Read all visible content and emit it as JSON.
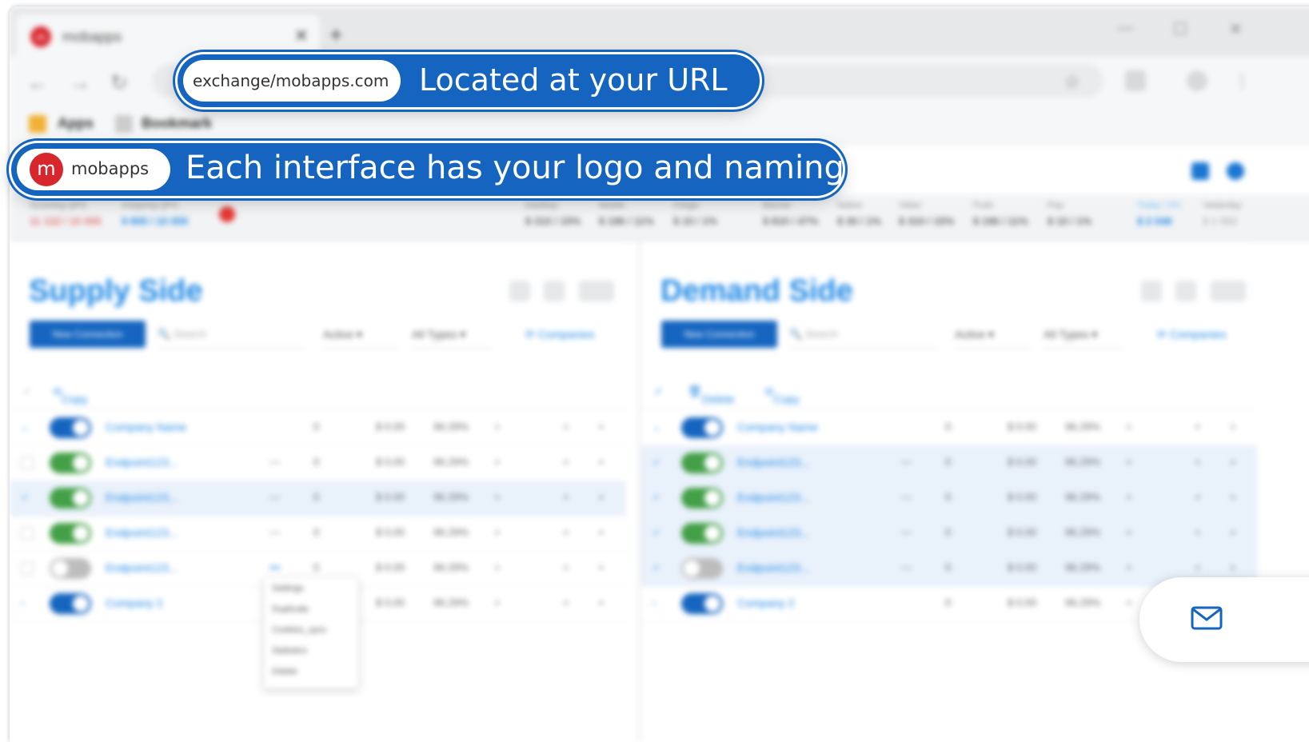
{
  "browser": {
    "tab_title": "mobapps",
    "tab_logo_letter": "m",
    "bookmarks": [
      {
        "label": "Apps"
      },
      {
        "label": "Bookmark"
      }
    ]
  },
  "stats": [
    {
      "label": "Incoming QPS",
      "value": "11 122 / 10 000"
    },
    {
      "label": "Outgoing QPS",
      "value": "9 800 / 10 000"
    },
    {
      "label": "Desktop",
      "value": "$ 310 / 15%"
    },
    {
      "label": "Mobile",
      "value": "$ 196 / 11%"
    },
    {
      "label": "Ctstge",
      "value": "$ 10 / 1%"
    },
    {
      "label": "Banner",
      "value": "$ 810 / 47%"
    },
    {
      "label": "Native",
      "value": "$ 30 / 1%"
    },
    {
      "label": "Video",
      "value": "$ 310 / 15%"
    },
    {
      "label": "Push",
      "value": "$ 196 / 11%"
    },
    {
      "label": "Pop",
      "value": "$ 10 / 1%"
    },
    {
      "label": "Today / 0%",
      "value": "$ 2 048"
    },
    {
      "label": "Yesterday",
      "value": "$ 1 992"
    }
  ],
  "supply": {
    "title": "Supply Side",
    "new_button": "New Connection",
    "search_placeholder": "Search",
    "status_select": "Active",
    "type_select": "All Types",
    "compare": "Companies",
    "bulk": [
      "Copy"
    ],
    "rows": [
      {
        "name": "Company Name",
        "dash": "",
        "count": "0",
        "money": "$ 0.00",
        "pct": "96.29%"
      },
      {
        "name": "Endpoint123...",
        "dash": "—",
        "count": "0",
        "money": "$ 0.00",
        "pct": "96.29%"
      },
      {
        "name": "Endpoint123...",
        "dash": "—",
        "count": "0",
        "money": "$ 0.00",
        "pct": "96.29%"
      },
      {
        "name": "Endpoint123...",
        "dash": "—",
        "count": "0",
        "money": "$ 0.00",
        "pct": "96.29%"
      },
      {
        "name": "Endpoint123...",
        "dash": "•••",
        "count": "0",
        "money": "$ 0.00",
        "pct": "96.29%"
      },
      {
        "name": "Company 2",
        "dash": "",
        "count": "0",
        "money": "$ 0.00",
        "pct": "96.29%"
      }
    ],
    "context_menu": [
      "Settings",
      "Duplicate",
      "Cookies_sync",
      "Statistics",
      "Delete"
    ]
  },
  "demand": {
    "title": "Demand Side",
    "new_button": "New Connection",
    "search_placeholder": "Search",
    "status_select": "Active",
    "type_select": "All Types",
    "compare": "Companies",
    "bulk": [
      "Delete",
      "Copy"
    ],
    "rows": [
      {
        "name": "Company Name",
        "dash": "",
        "count": "0",
        "money": "$ 0.00",
        "pct": "96.29%"
      },
      {
        "name": "Endpoint123...",
        "dash": "—",
        "count": "0",
        "money": "$ 0.00",
        "pct": "96.29%"
      },
      {
        "name": "Endpoint123...",
        "dash": "—",
        "count": "0",
        "money": "$ 0.00",
        "pct": "96.29%"
      },
      {
        "name": "Endpoint123...",
        "dash": "—",
        "count": "0",
        "money": "$ 0.00",
        "pct": "96.29%"
      },
      {
        "name": "Endpoint123...",
        "dash": "—",
        "count": "0",
        "money": "$ 0.00",
        "pct": "96.29%"
      },
      {
        "name": "Company 2",
        "dash": "",
        "count": "0",
        "money": "$ 0.00",
        "pct": "96.29%"
      }
    ]
  },
  "callouts": {
    "url": {
      "url_text": "exchange/mobapps.com",
      "caption": "Located at your URL"
    },
    "logo": {
      "logo_letter": "m",
      "brand_name": "mobapps",
      "caption": "Each interface has your logo and naming"
    }
  },
  "colors": {
    "accent": "#1565c0",
    "brand": "#d8262d",
    "toggle_on": "#43a047"
  },
  "icons": {
    "mail": "mail-icon"
  }
}
